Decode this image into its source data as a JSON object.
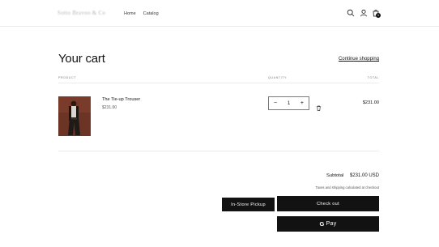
{
  "header": {
    "logo": "Sotto Bravoo & Co",
    "nav": [
      "Home",
      "Catalog"
    ],
    "cart_count": "1"
  },
  "cart": {
    "title": "Your cart",
    "continue_label": "Continue shopping",
    "columns": {
      "product": "PRODUCT",
      "quantity": "QUANTITY",
      "total": "TOTAL"
    }
  },
  "item": {
    "name": "The Tie-up Trouser",
    "price": "$231.00",
    "quantity": "1",
    "total": "$231.00"
  },
  "summary": {
    "subtotal_label": "Subtotal",
    "subtotal_value": "$231.00 USD",
    "tax_note": "Taxes and shipping calculated at checkout",
    "pickup_label": "In-Store Pickup",
    "checkout_label": "Check out",
    "gpay_label": "Pay",
    "gpay_g": "G"
  },
  "icons": {
    "search": "search-icon",
    "account": "account-icon",
    "cart": "cart-icon",
    "trash": "trash-icon"
  }
}
